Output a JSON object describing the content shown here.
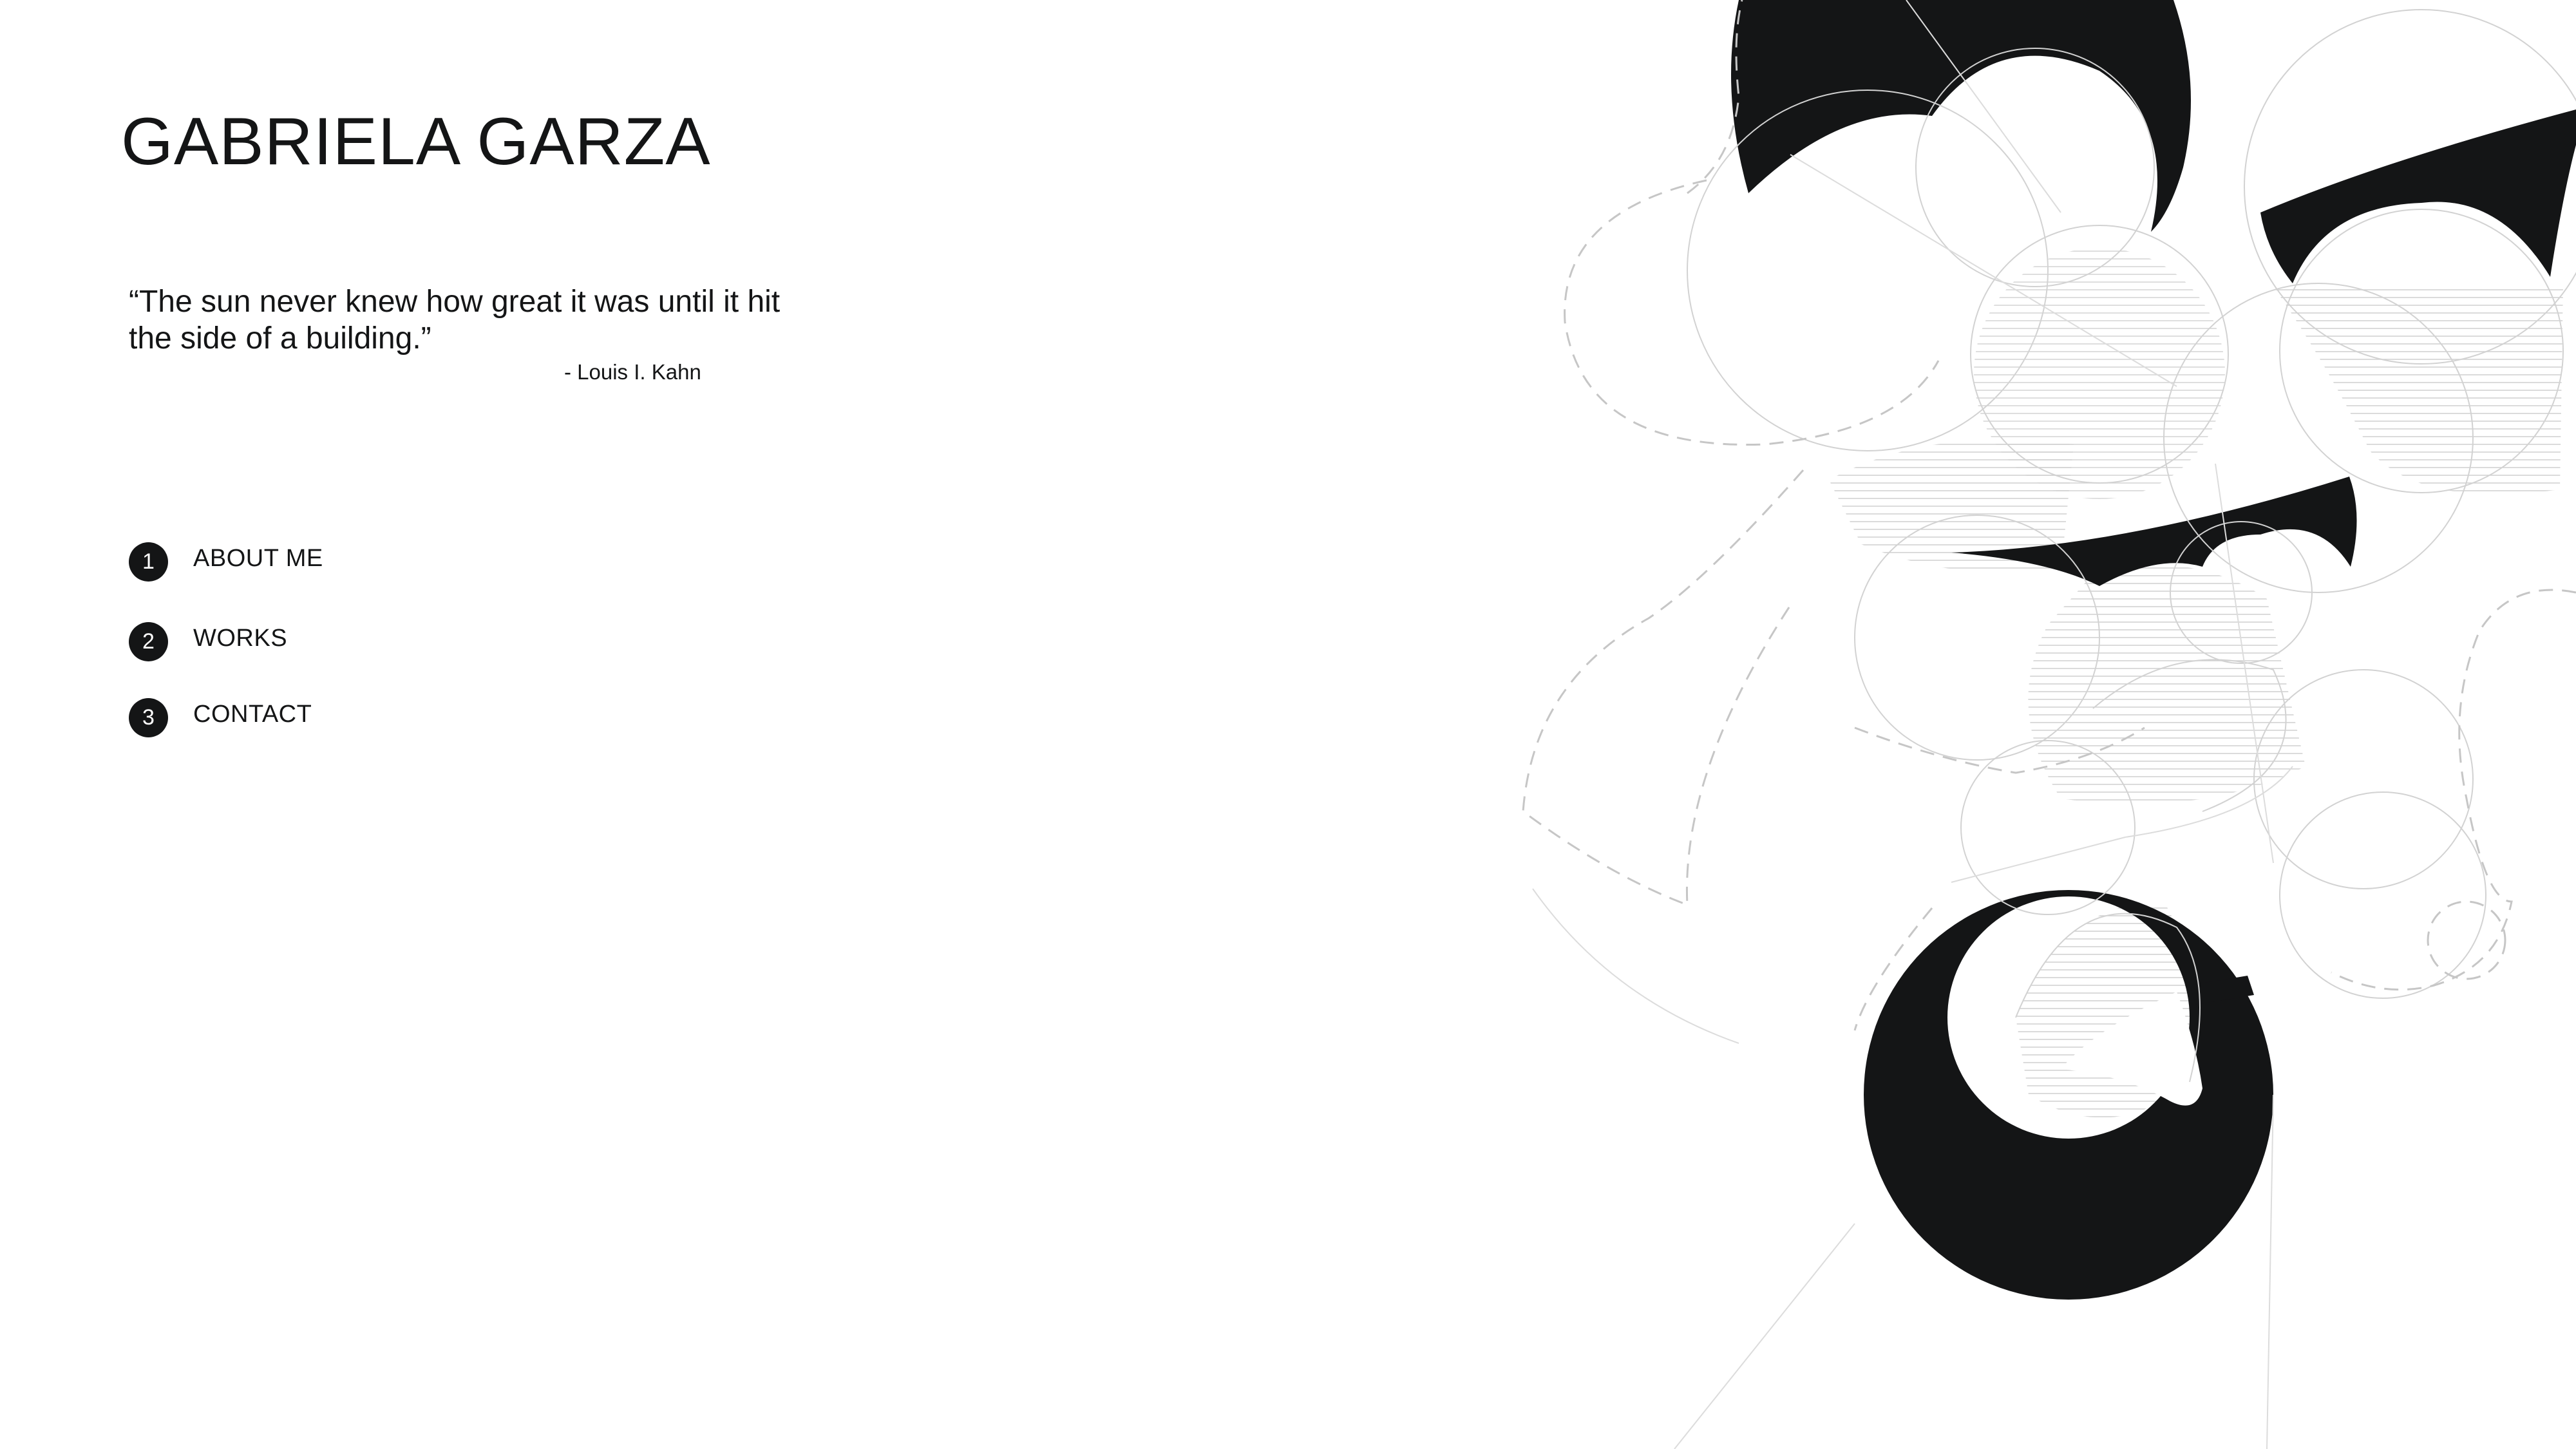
{
  "site": {
    "title": "GABRIELA GARZA"
  },
  "quote": {
    "text": "“The sun never knew how great it was until it hit the side of a building.”",
    "author": "- Louis I. Kahn"
  },
  "nav": {
    "items": [
      {
        "number": "1",
        "label": "ABOUT ME"
      },
      {
        "number": "2",
        "label": "WORKS"
      },
      {
        "number": "3",
        "label": "CONTACT"
      }
    ]
  },
  "colors": {
    "ink": "#141516",
    "background": "#ffffff",
    "linework": "#c8c8c8"
  }
}
